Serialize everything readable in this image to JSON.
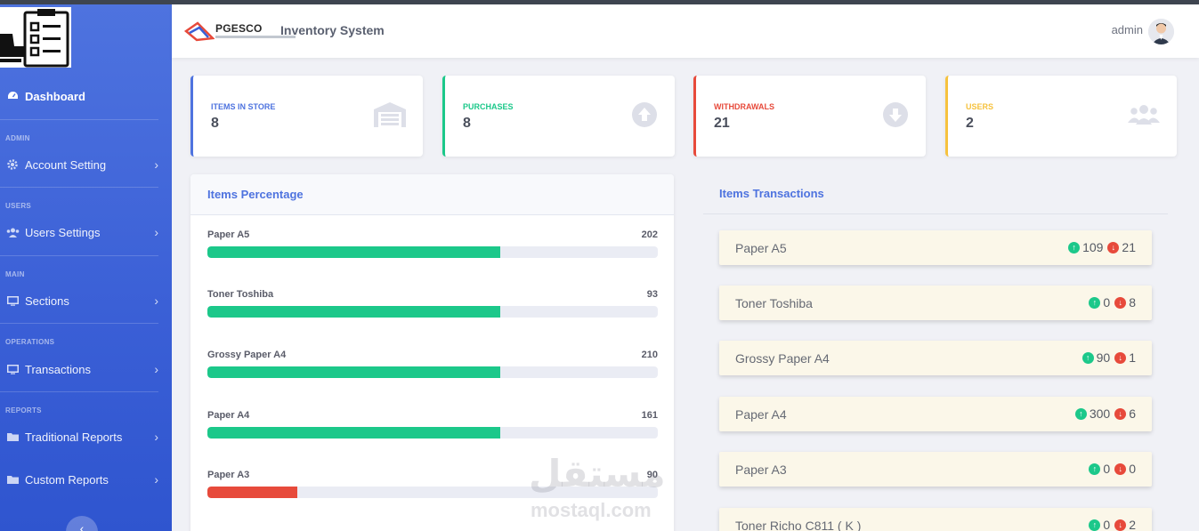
{
  "app": {
    "brand": "PGESCO",
    "title": "Inventory System",
    "user": "admin"
  },
  "sidebar": {
    "dashboard": "Dashboard",
    "sections": [
      {
        "heading": "ADMIN",
        "item": "Account Setting"
      },
      {
        "heading": "USERS",
        "item": "Users Settings"
      },
      {
        "heading": "MAIN",
        "item": "Sections"
      },
      {
        "heading": "OPERATIONS",
        "item": "Transactions"
      },
      {
        "heading": "REPORTS",
        "item": "Traditional Reports"
      },
      {
        "heading": "",
        "item": "Custom Reports"
      }
    ]
  },
  "cards": [
    {
      "title": "ITEMS IN STORE",
      "value": "8",
      "color": "#4e73df",
      "icon": "warehouse-icon"
    },
    {
      "title": "PURCHASES",
      "value": "8",
      "color": "#1cc88a",
      "icon": "arrow-up-circle-icon"
    },
    {
      "title": "WITHDRAWALS",
      "value": "21",
      "color": "#e74a3b",
      "icon": "arrow-down-circle-icon"
    },
    {
      "title": "USERS",
      "value": "2",
      "color": "#f6c23e",
      "icon": "users-icon"
    }
  ],
  "percentage": {
    "title": "Items Percentage",
    "items": [
      {
        "name": "Paper A5",
        "value": "202",
        "fill": 0.65,
        "color": "#1cc88a"
      },
      {
        "name": "Toner Toshiba",
        "value": "93",
        "fill": 0.65,
        "color": "#1cc88a"
      },
      {
        "name": "Grossy Paper A4",
        "value": "210",
        "fill": 0.65,
        "color": "#1cc88a"
      },
      {
        "name": "Paper A4",
        "value": "161",
        "fill": 0.65,
        "color": "#1cc88a"
      },
      {
        "name": "Paper A3",
        "value": "90",
        "fill": 0.2,
        "color": "#e74a3b"
      }
    ]
  },
  "transactions": {
    "title": "Items Transactions",
    "items": [
      {
        "name": "Paper A5",
        "in": "109",
        "out": "21"
      },
      {
        "name": "Toner Toshiba",
        "in": "0",
        "out": "8"
      },
      {
        "name": "Grossy Paper A4",
        "in": "90",
        "out": "1"
      },
      {
        "name": "Paper A4",
        "in": "300",
        "out": "6"
      },
      {
        "name": "Paper A3",
        "in": "0",
        "out": "0"
      },
      {
        "name": "Toner Richo C811 ( K )",
        "in": "0",
        "out": "2"
      }
    ]
  },
  "watermark": {
    "arabic": "مستقل",
    "latin": "mostaql.com"
  }
}
